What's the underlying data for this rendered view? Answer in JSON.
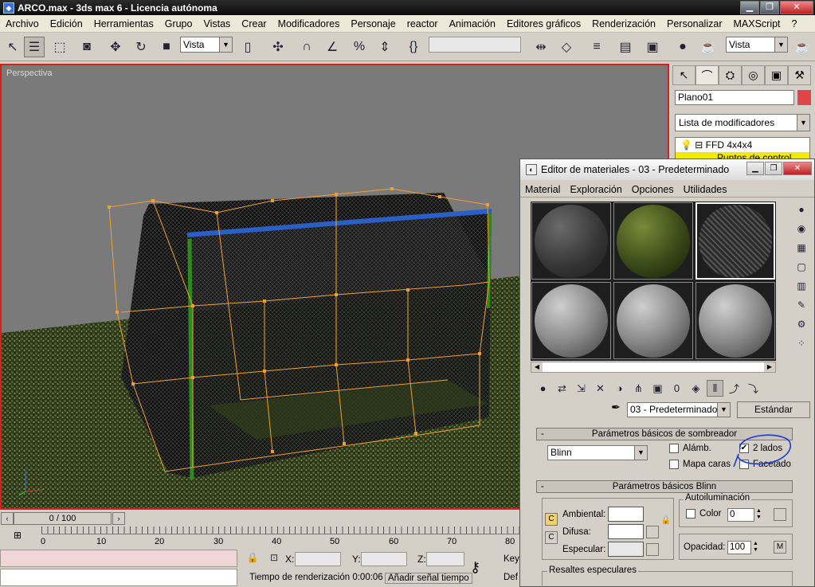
{
  "window": {
    "title": "ARCO.max - 3ds max 6 - Licencia autónoma"
  },
  "menu": [
    "Archivo",
    "Edición",
    "Herramientas",
    "Grupo",
    "Vistas",
    "Crear",
    "Modificadores",
    "Personaje",
    "reactor",
    "Animación",
    "Editores gráficos",
    "Renderización",
    "Personalizar",
    "MAXScript",
    "?"
  ],
  "toolbar": {
    "view_combo": "Vista",
    "view_combo2": "Vista"
  },
  "viewport": {
    "label": "Perspectiva"
  },
  "command_panel": {
    "object_name": "Plano01",
    "object_color": "#e04545",
    "modifier_list": "Lista de modificadores",
    "stack": {
      "modifier": "FFD 4x4x4",
      "sub": "Puntos de control"
    }
  },
  "material_editor": {
    "title": "Editor de materiales - 03 - Predeterminado",
    "menu": [
      "Material",
      "Exploración",
      "Opciones",
      "Utilidades"
    ],
    "material_name": "03 - Predeterminado",
    "type_button": "Estándar",
    "shader_rollout": {
      "title": "Parámetros básicos de sombreador",
      "shader": "Blinn",
      "wire": {
        "label": "Alámb.",
        "checked": false
      },
      "two_sided": {
        "label": "2 lados",
        "checked": true
      },
      "face_map": {
        "label": "Mapa caras",
        "checked": false
      },
      "faceted": {
        "label": "Facetado",
        "checked": false
      }
    },
    "blinn_rollout": {
      "title": "Parámetros básicos Blinn",
      "self_illum": {
        "group": "Autoiluminación",
        "color_label": "Color",
        "value": "0"
      },
      "ambient_label": "Ambiental:",
      "diffuse_label": "Difusa:",
      "specular_label": "Especular:",
      "opacity_label": "Opacidad:",
      "opacity_value": "100",
      "map_button": "M",
      "specular_highlights": "Resaltes especulares"
    }
  },
  "timeline": {
    "frame": "0 / 100",
    "ticks": [
      "0",
      "10",
      "20",
      "30",
      "40",
      "50",
      "60",
      "70",
      "80"
    ]
  },
  "status": {
    "x_label": "X:",
    "y_label": "Y:",
    "z_label": "Z:",
    "render_time": "Tiempo de renderización  0:00:06",
    "add_time_tag": "Añadir señal tiempo",
    "key_label": "Key",
    "def_label": "Def"
  }
}
